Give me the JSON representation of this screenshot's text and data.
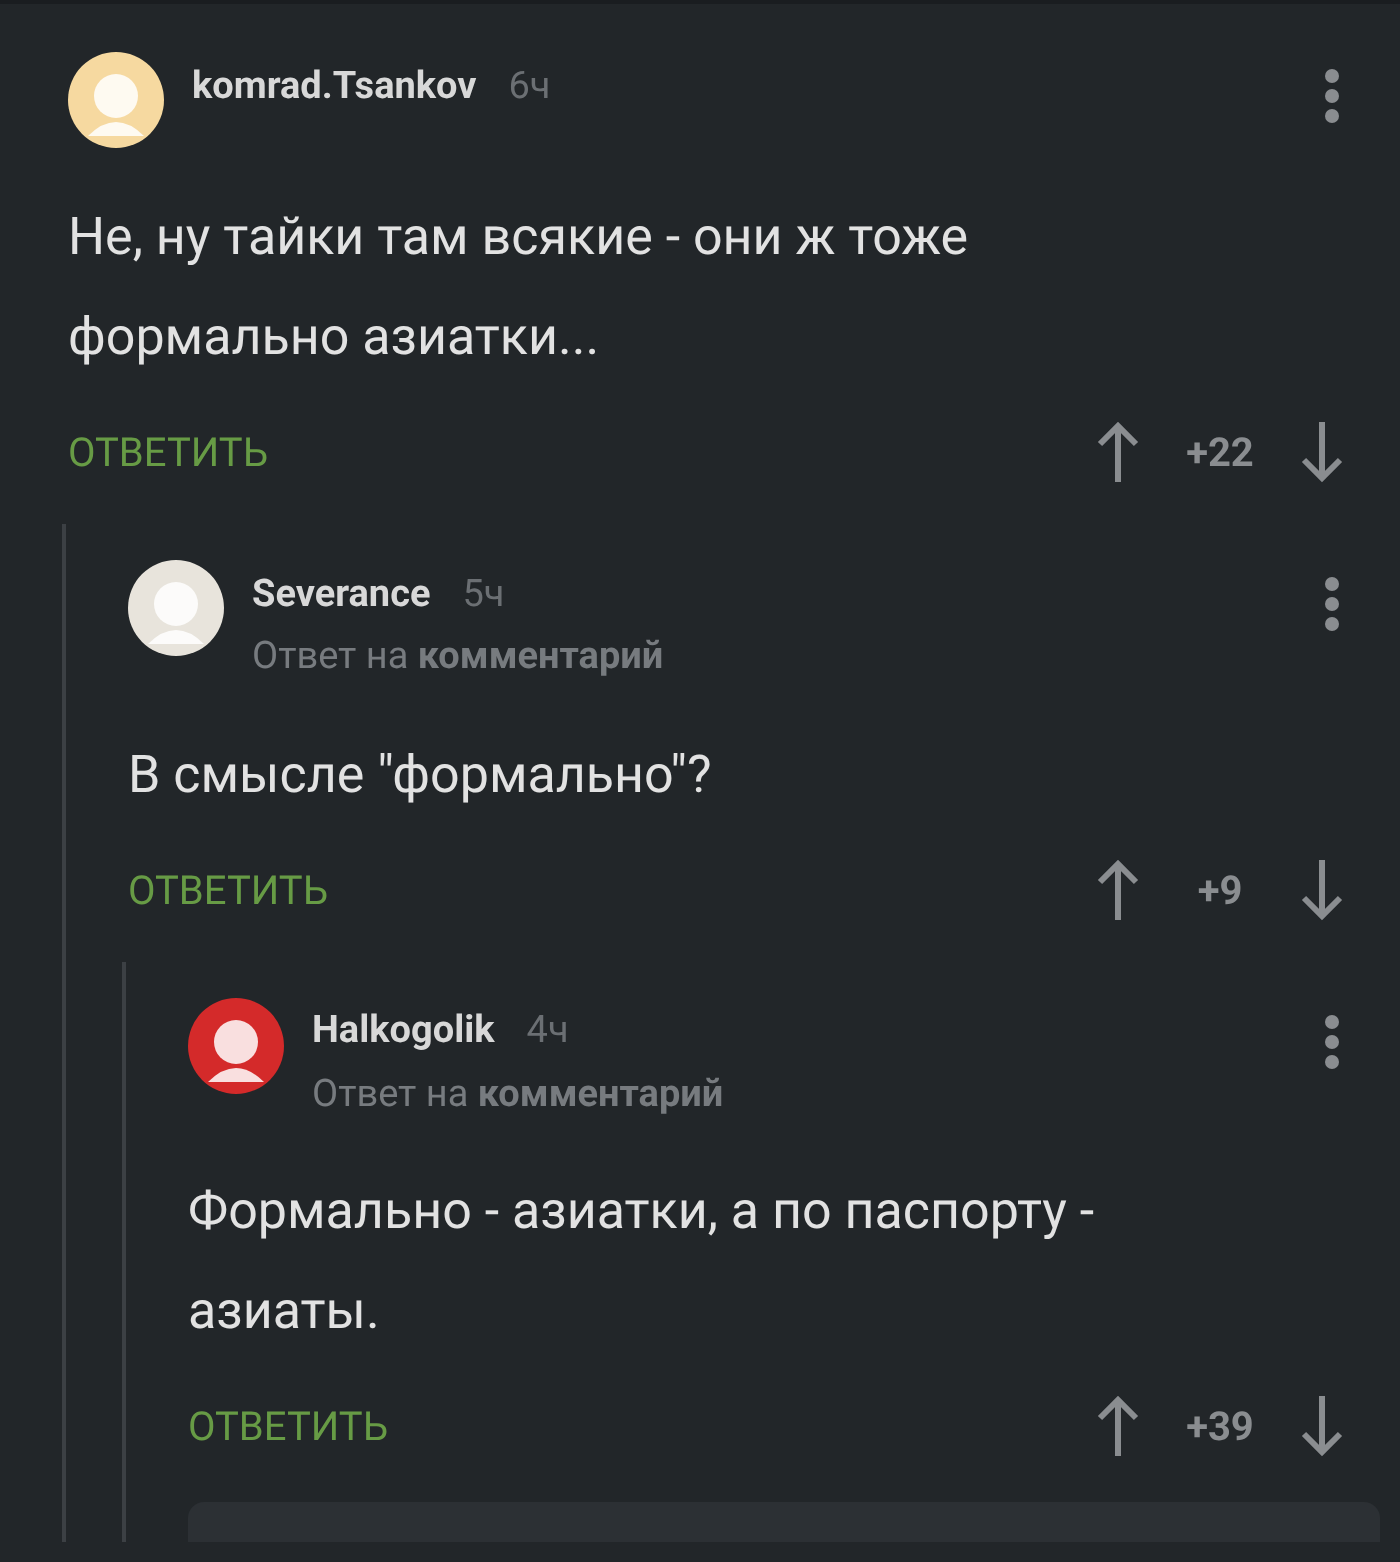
{
  "comments": [
    {
      "author": "komrad.Tsankov",
      "time": "6ч",
      "text": "Не, ну тайки там всякие - они ж тоже формально азиатки...",
      "reply_label": "ОТВЕТИТЬ",
      "rating": "+22",
      "color": "#f6d9a0",
      "children": [
        {
          "author": "Severance",
          "time": "5ч",
          "text": "В смысле \"формально\"?",
          "reply_to": "Ответ на **комментарий**",
          "reply_label": "ОТВЕТИТЬ",
          "rating": "+9",
          "color": "#e8e4dc",
          "children": [
            {
              "author": "Halkogolik",
              "time": "4ч",
              "text": "Формально - азиатки, а по паспорту - азиаты.",
              "reply_to": "Ответ на **комментарий**",
              "reply_label": "ОТВЕТИТЬ",
              "rating": "+39",
              "color": "#d42a2a"
            }
          ]
        }
      ]
    }
  ]
}
